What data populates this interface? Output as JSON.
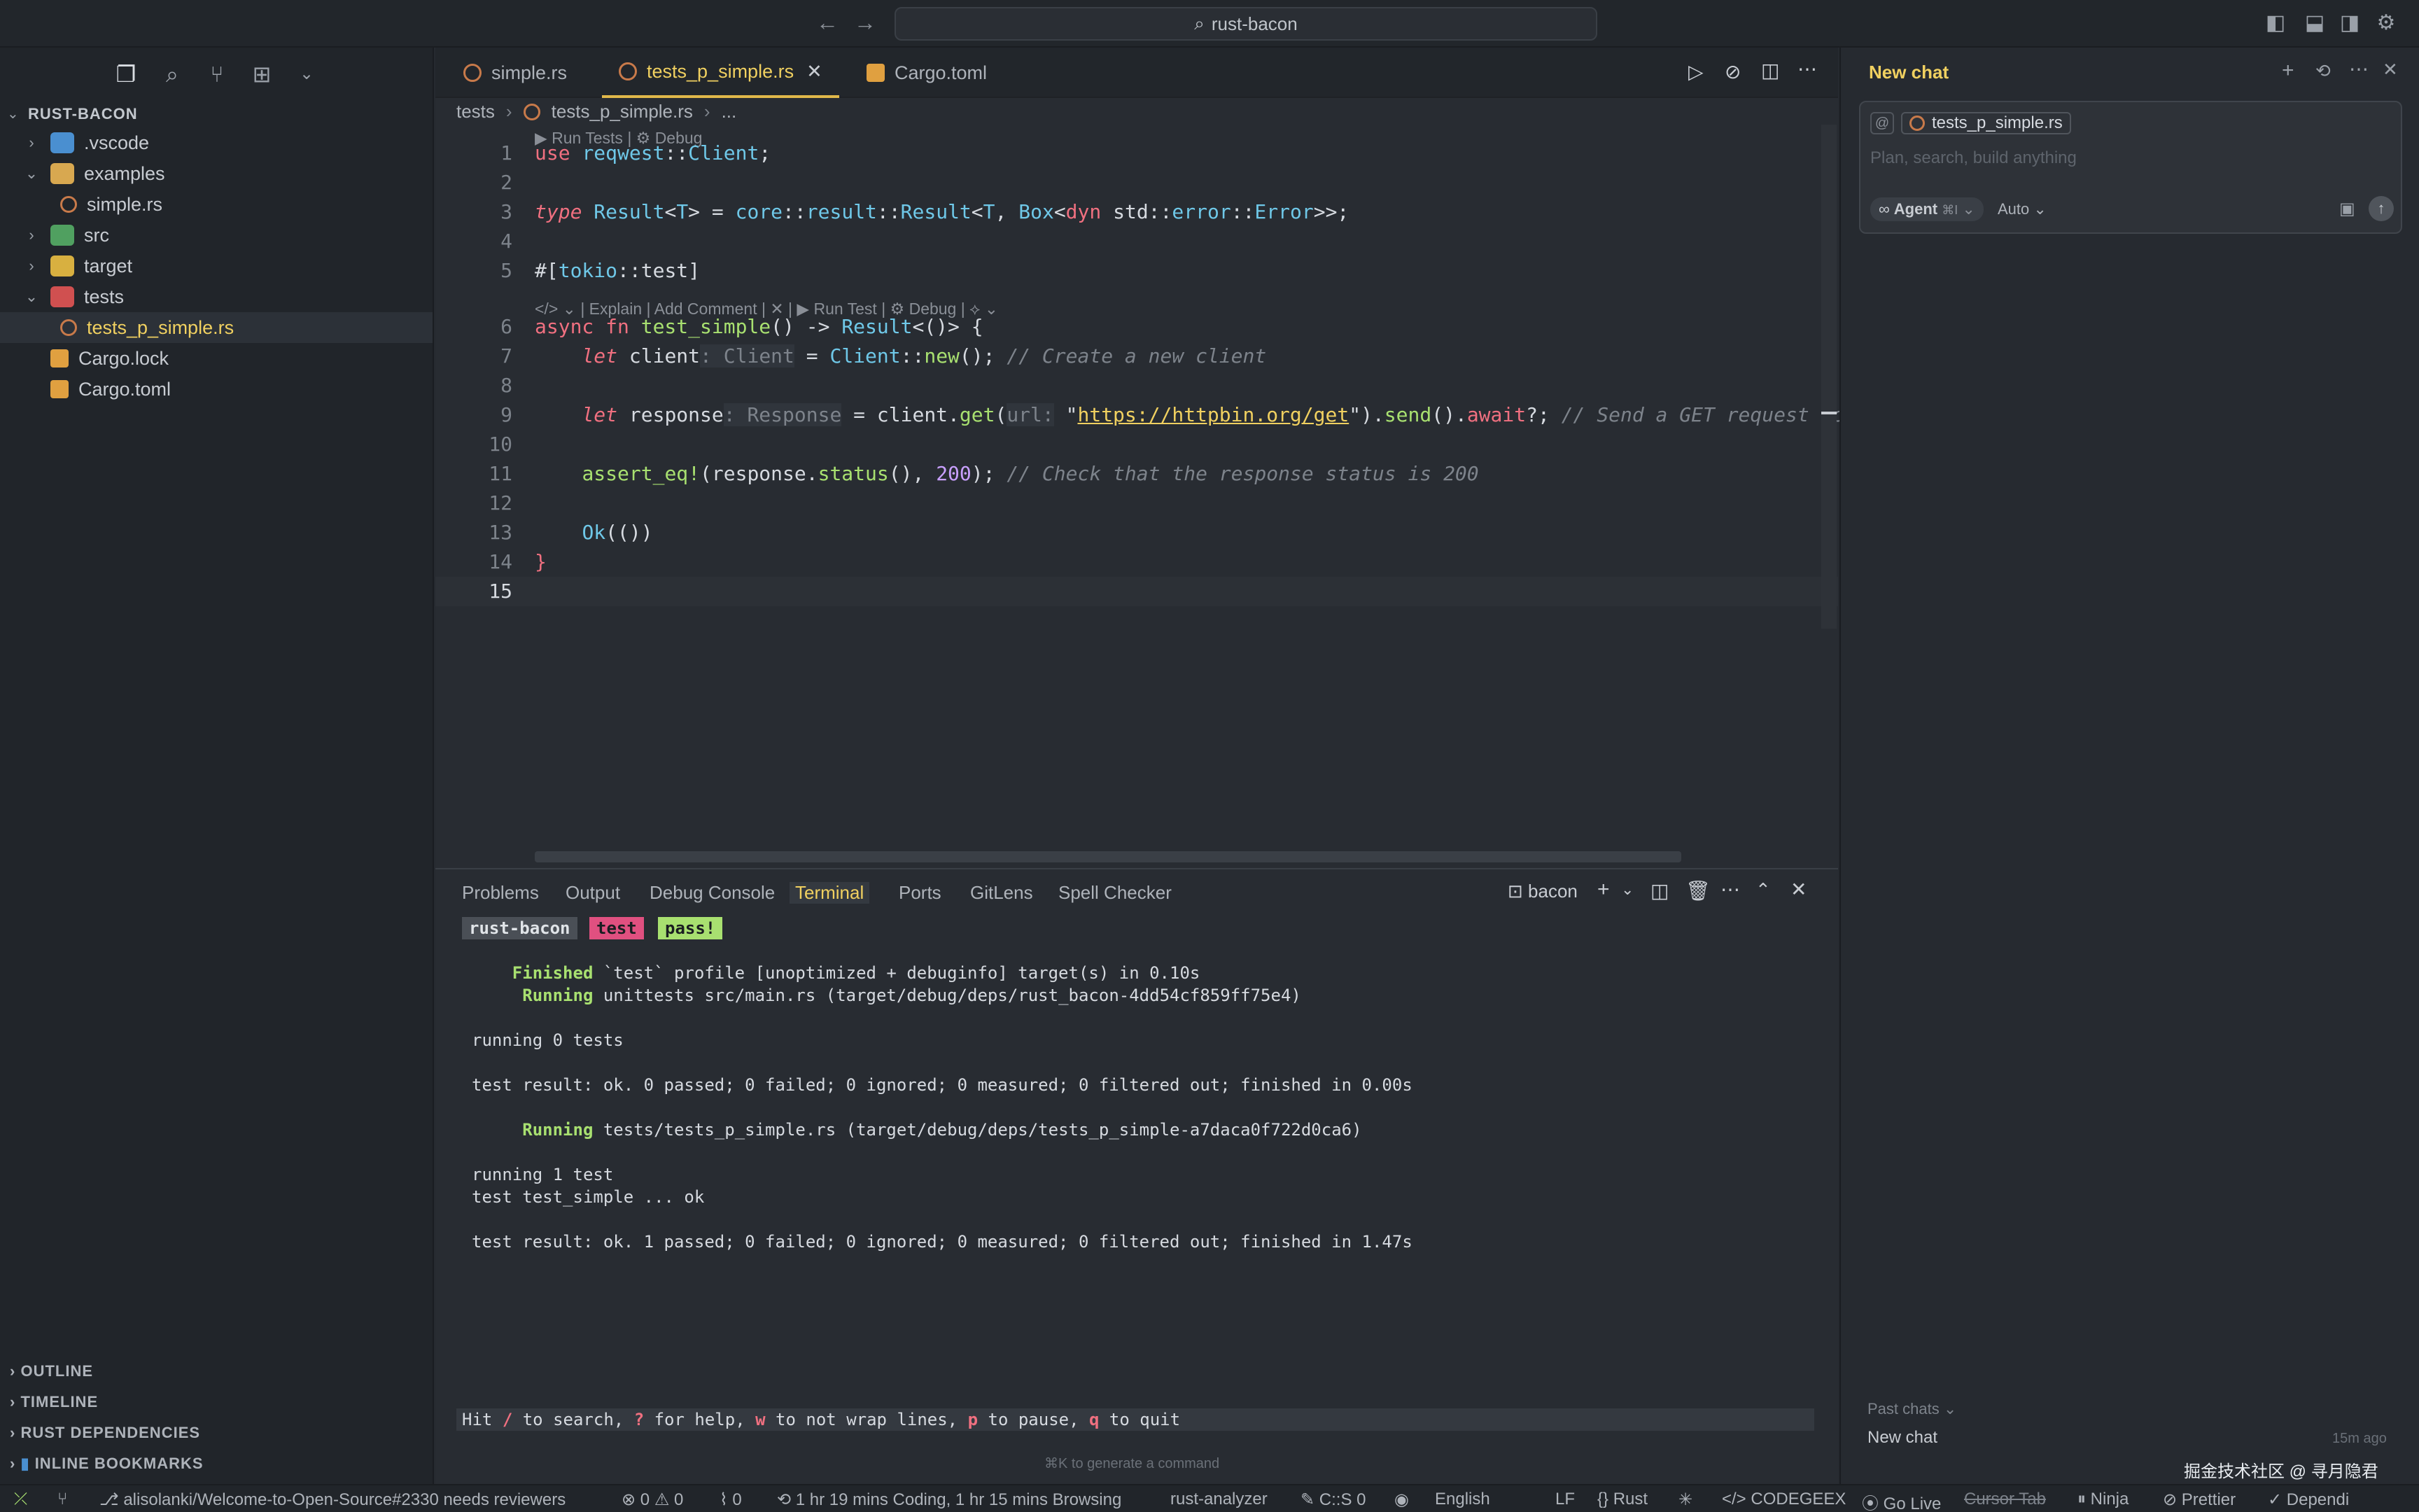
{
  "titlebar": {
    "search_text": "rust-bacon"
  },
  "sidebar": {
    "root": "RUST-BACON",
    "items": [
      {
        "label": ".vscode",
        "depth": 0,
        "type": "folder"
      },
      {
        "label": "examples",
        "depth": 0,
        "type": "folder-open"
      },
      {
        "label": "simple.rs",
        "depth": 1,
        "type": "rs"
      },
      {
        "label": "src",
        "depth": 0,
        "type": "folder"
      },
      {
        "label": "target",
        "depth": 0,
        "type": "folder"
      },
      {
        "label": "tests",
        "depth": 0,
        "type": "folder-open"
      },
      {
        "label": "tests_p_simple.rs",
        "depth": 1,
        "type": "rs",
        "selected": true
      },
      {
        "label": "Cargo.lock",
        "depth": 0,
        "type": "toml"
      },
      {
        "label": "Cargo.toml",
        "depth": 0,
        "type": "toml"
      }
    ],
    "sections": [
      "OUTLINE",
      "TIMELINE",
      "RUST DEPENDENCIES",
      "INLINE BOOKMARKS"
    ]
  },
  "editor": {
    "tabs": [
      {
        "label": "simple.rs",
        "active": false
      },
      {
        "label": "tests_p_simple.rs",
        "active": true
      },
      {
        "label": "Cargo.toml",
        "active": false
      }
    ],
    "breadcrumb": [
      "tests",
      "tests_p_simple.rs",
      "..."
    ],
    "lens_top": "▶ Run Tests | ⚙ Debug",
    "lens_fn": "| Explain | Add Comment |  ✕  | ▶ Run Test | ⚙ Debug |",
    "line_numbers": [
      "1",
      "2",
      "3",
      "4",
      "5",
      "6",
      "7",
      "8",
      "9",
      "10",
      "11",
      "12",
      "13",
      "14",
      "15"
    ]
  },
  "panel": {
    "tabs": [
      "Problems",
      "Output",
      "Debug Console",
      "Terminal",
      "Ports",
      "GitLens",
      "Spell Checker"
    ],
    "active_tab": "Terminal",
    "terminal_name": "bacon",
    "badges": [
      "rust-bacon",
      "test",
      "pass!"
    ],
    "lines": [
      {
        "prefix": "Finished",
        "text": " `test` profile [unoptimized + debuginfo] target(s) in 0.10s",
        "indent": "    "
      },
      {
        "prefix": "Running",
        "text": " unittests src/main.rs (target/debug/deps/rust_bacon-4dd54cf859ff75e4)",
        "indent": "     "
      },
      {
        "prefix": "",
        "text": "",
        "indent": ""
      },
      {
        "prefix": "",
        "text": "running 0 tests",
        "indent": ""
      },
      {
        "prefix": "",
        "text": "",
        "indent": ""
      },
      {
        "prefix": "",
        "text": "test result: ok. 0 passed; 0 failed; 0 ignored; 0 measured; 0 filtered out; finished in 0.00s",
        "indent": ""
      },
      {
        "prefix": "",
        "text": "",
        "indent": ""
      },
      {
        "prefix": "Running",
        "text": " tests/tests_p_simple.rs (target/debug/deps/tests_p_simple-a7daca0f722d0ca6)",
        "indent": "     "
      },
      {
        "prefix": "",
        "text": "",
        "indent": ""
      },
      {
        "prefix": "",
        "text": "running 1 test",
        "indent": ""
      },
      {
        "prefix": "",
        "text": "test test_simple ... ok",
        "indent": ""
      },
      {
        "prefix": "",
        "text": "",
        "indent": ""
      },
      {
        "prefix": "",
        "text": "test result: ok. 1 passed; 0 failed; 0 ignored; 0 measured; 0 filtered out; finished in 1.47s",
        "indent": ""
      }
    ],
    "help_line": "Hit / to search, ? for help, w to not wrap lines, p to pause, q to quit",
    "cmd_hint": "⌘K to generate a command"
  },
  "chat": {
    "title": "New chat",
    "context_file": "tests_p_simple.rs",
    "placeholder": "Plan, search, build anything",
    "mode": "Agent",
    "mode_shortcut": "⌘I",
    "model": "Auto",
    "past_chats_label": "Past chats",
    "past_chats": [
      {
        "title": "New chat",
        "time": "15m ago"
      }
    ],
    "watermark": "掘金技术社区 @ 寻月隐君"
  },
  "statusbar": {
    "branch": "alisolanki/Welcome-to-Open-Source#2330 needs reviewers",
    "errors": "0",
    "warnings": "0",
    "ports": "0",
    "time": "1 hr 19 mins Coding, 1 hr 15 mins Browsing",
    "analyzer": "rust-analyzer",
    "cs": "C::S 0",
    "lang_input": "English",
    "eol": "LF",
    "language": "Rust",
    "codegeex": "CODEGEEX",
    "golive": "Go Live",
    "cursor_tab": "Cursor Tab",
    "ninja": "Ninja",
    "prettier": "Prettier",
    "dependi": "Dependi"
  },
  "colors": {
    "accent": "#f0d060",
    "keyword": "#f07080",
    "type": "#6fc8e8",
    "function": "#a8e070"
  }
}
